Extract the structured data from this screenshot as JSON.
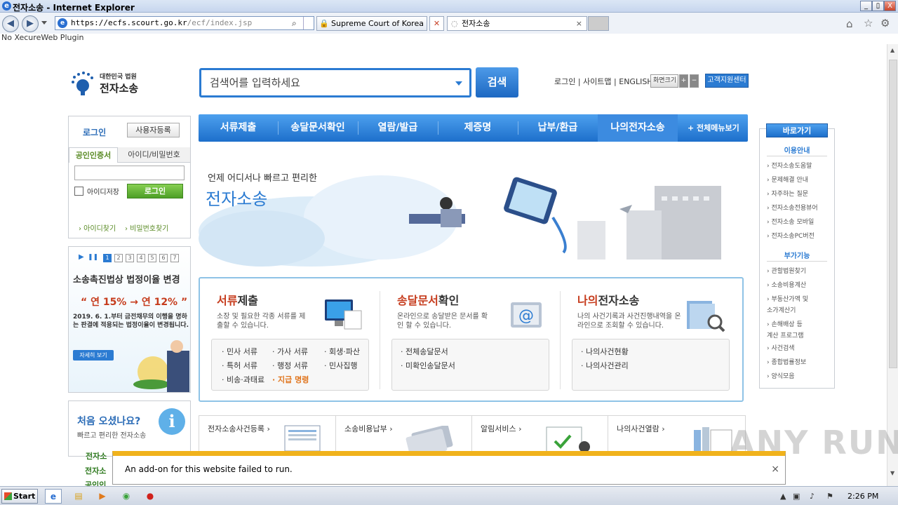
{
  "window": {
    "title": "전자소송 - Internet Explorer",
    "min": "_",
    "restore": "▯",
    "close": "X"
  },
  "browser": {
    "url_prefix": "https://",
    "url_host": "ecfs.scourt.go.kr",
    "url_path": "/ecf/index.jsp",
    "cert_tab": "Supreme Court of Korea [...",
    "tab_title": "전자소송",
    "tab_close": "×",
    "plugin_msg": "No XecureWeb Plugin"
  },
  "header": {
    "logo_small": "대한민국 법원",
    "logo_big": "전자소송",
    "search_placeholder": "검색어를 입력하세요",
    "search_button": "검색",
    "links": "로그인 | 사이트맵 | ENGLISH",
    "font_size_label": "화면크기",
    "font_plus": "+",
    "font_minus": "−",
    "support": "고객지원센터"
  },
  "login": {
    "title": "로그인",
    "register": "사용자등록",
    "tab_cert": "공인인증서",
    "tab_id": "아이디/비밀번호",
    "save_id": "아이디저장",
    "login_button": "로그인",
    "find_id": "› 아이디찾기",
    "find_pw": "› 비밀번호찾기"
  },
  "banner": {
    "pages": [
      "1",
      "2",
      "3",
      "4",
      "5",
      "6",
      "7"
    ],
    "play": "▶",
    "pause": "❚❚",
    "title": "소송촉진법상 법정이율 변경",
    "rate": "“ 연 15% → 연 12% ”",
    "desc": "2019. 6. 1.부터 금전채무의 이행을 명하는 판결에 적용되는 법정이율이 변경됩니다.",
    "more": "자세히 보기"
  },
  "first_visit": {
    "question": "처음 오셨나요?",
    "sub": "빠르고 편리한 전자소송",
    "items": [
      "전자소",
      "전자소",
      "공인인"
    ]
  },
  "gnb": {
    "items": [
      "서류제출",
      "송달문서확인",
      "열람/발급",
      "제증명",
      "납부/환급",
      "나의전자소송"
    ],
    "all_menu": "+ 전체메뉴보기"
  },
  "hero": {
    "line1": "언제 어디서나 빠르고 편리한",
    "line2": "전자소송"
  },
  "services": [
    {
      "title_hl": "서류",
      "title_rest": "제출",
      "desc": "소장 및 필요한 각종 서류를 제출할 수 있습니다.",
      "links": [
        "· 민사 서류",
        "· 가사 서류",
        "· 회생·파산",
        "· 특허 서류",
        "· 행정 서류",
        "· 민사집행",
        "· 비송·과태료",
        "· 지급 명령"
      ]
    },
    {
      "title_hl": "송달문서",
      "title_rest": "확인",
      "desc": "온라인으로 송달받은 문서를 확인 할 수 있습니다.",
      "links": [
        "· 전체송달문서",
        "· 미확인송달문서"
      ]
    },
    {
      "title_hl": "나의",
      "title_rest": "전자소송",
      "desc": "나의 사건기록과 사건진행내역을 온라인으로 조회할 수 있습니다.",
      "links": [
        "· 나의사건현황",
        "· 나의사건관리"
      ]
    }
  ],
  "quick": {
    "header": "바로가기",
    "sec1": "이용안내",
    "sec1_items": [
      "› 전자소송도움말",
      "› 문제해결 안내",
      "› 자주하는 질문",
      "› 전자소송전용뷰어",
      "› 전자소송 모바일",
      "› 전자소송PC버전"
    ],
    "sec2": "부가기능",
    "sec2_items": [
      "› 관할법원찾기",
      "› 소송비용계산",
      "› 부동산가액 및",
      "  소가계산기",
      "› 손해배상 등",
      "  계산 프로그램",
      "› 사건검색",
      "› 종합법률정보",
      "› 양식모음"
    ]
  },
  "cards": [
    "전자소송사건등록 ›",
    "소송비용납부 ›",
    "알림서비스 ›",
    "나의사건열람 ›"
  ],
  "notification": {
    "message": "An add-on for this website failed to run.",
    "close": "×"
  },
  "taskbar": {
    "start": "Start",
    "time": "2:26 PM"
  },
  "watermark": "ANY RUN"
}
